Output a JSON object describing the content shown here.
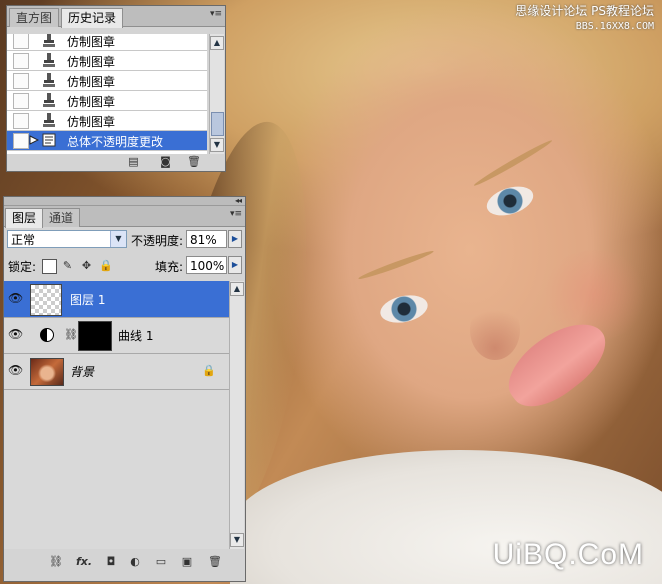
{
  "watermark_top": {
    "line1": "思缘设计论坛",
    "line2": "PS教程论坛",
    "site": "BBS.16XX8.COM"
  },
  "watermark_bottom": "UiBQ.CoM",
  "history_panel": {
    "tabs": [
      {
        "label": "直方图"
      },
      {
        "label": "历史记录",
        "active": true
      }
    ],
    "items": [
      {
        "label": "仿制图章",
        "icon": "clone-stamp-icon"
      },
      {
        "label": "仿制图章",
        "icon": "clone-stamp-icon"
      },
      {
        "label": "仿制图章",
        "icon": "clone-stamp-icon"
      },
      {
        "label": "仿制图章",
        "icon": "clone-stamp-icon"
      },
      {
        "label": "仿制图章",
        "icon": "clone-stamp-icon"
      },
      {
        "label": "总体不透明度更改",
        "icon": "history-state-icon",
        "selected": true
      }
    ],
    "footer_icons": [
      "new-document-from-state-icon",
      "new-snapshot-icon",
      "trash-icon"
    ]
  },
  "layers_panel": {
    "tabs": [
      {
        "label": "图层",
        "active": true
      },
      {
        "label": "通道"
      }
    ],
    "blend_mode": "正常",
    "opacity_label": "不透明度:",
    "opacity_value": "81%",
    "lock_label": "锁定:",
    "fill_label": "填充:",
    "fill_value": "100%",
    "layers": [
      {
        "name": "图层 1",
        "selected": true,
        "visible": true
      },
      {
        "name": "曲线 1",
        "visible": true,
        "adjustment": "curves"
      },
      {
        "name": "背景",
        "visible": true,
        "locked": true
      }
    ],
    "footer_icons": [
      "link-layers-icon",
      "fx-icon",
      "layer-mask-icon",
      "adjustment-layer-icon",
      "group-icon",
      "new-layer-icon",
      "trash-icon"
    ],
    "fx_label": "fx."
  },
  "colors": {
    "selection": "#3a6fd4",
    "panel_bg": "#d4d4d4"
  }
}
